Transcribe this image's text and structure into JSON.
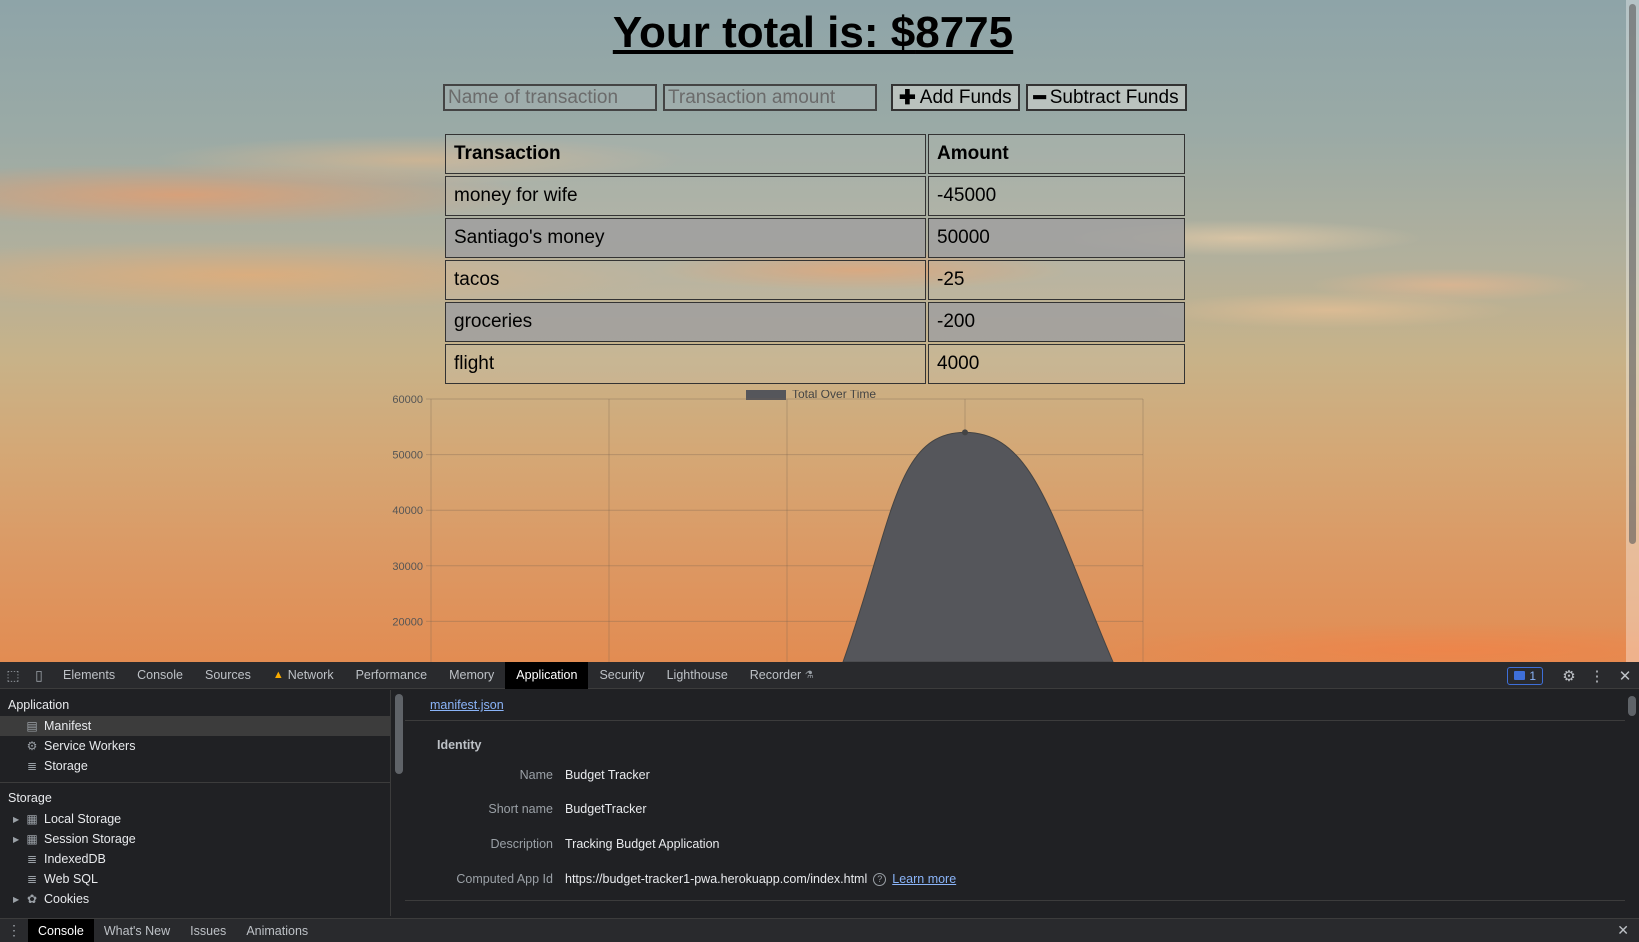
{
  "page": {
    "total_label": "Your total is: $",
    "total_value": "8775",
    "name_placeholder": "Name of transaction",
    "amount_placeholder": "Transaction amount",
    "add_label": "Add Funds",
    "subtract_label": "Subtract Funds",
    "add_icon": "plus-icon",
    "subtract_icon": "minus-icon"
  },
  "table": {
    "headers": [
      "Transaction",
      "Amount"
    ],
    "rows": [
      {
        "name": "money for wife",
        "amount": "-45000"
      },
      {
        "name": "Santiago's money",
        "amount": "50000"
      },
      {
        "name": "tacos",
        "amount": "-25"
      },
      {
        "name": "groceries",
        "amount": "-200"
      },
      {
        "name": "flight",
        "amount": "4000"
      }
    ]
  },
  "chart_data": {
    "type": "area",
    "title": "",
    "legend": [
      "Total Over Time"
    ],
    "legend_position": "top",
    "series": [
      {
        "name": "Total Over Time",
        "color": "#55565b",
        "points_visible": [
          {
            "x": 3,
            "y": 54000
          }
        ]
      }
    ],
    "y_ticks_visible": [
      60000,
      50000,
      40000,
      30000,
      20000
    ],
    "grid": true
  },
  "devtools": {
    "tabs": [
      "Elements",
      "Console",
      "Sources",
      "Network",
      "Performance",
      "Memory",
      "Application",
      "Security",
      "Lighthouse",
      "Recorder"
    ],
    "active_tab": "Application",
    "issues_count": "1",
    "sidebar": {
      "application_title": "Application",
      "application_items": [
        {
          "label": "Manifest",
          "icon": "file-icon"
        },
        {
          "label": "Service Workers",
          "icon": "gear-icon"
        },
        {
          "label": "Storage",
          "icon": "database-icon"
        }
      ],
      "storage_title": "Storage",
      "storage_items": [
        {
          "label": "Local Storage",
          "icon": "grid-icon",
          "expandable": true
        },
        {
          "label": "Session Storage",
          "icon": "grid-icon",
          "expandable": true
        },
        {
          "label": "IndexedDB",
          "icon": "database-icon",
          "expandable": false
        },
        {
          "label": "Web SQL",
          "icon": "database-icon",
          "expandable": false
        },
        {
          "label": "Cookies",
          "icon": "cookie-icon",
          "expandable": true
        }
      ]
    },
    "manifest": {
      "link": "manifest.json",
      "identity_title": "Identity",
      "fields": [
        {
          "label": "Name",
          "value": "Budget Tracker"
        },
        {
          "label": "Short name",
          "value": "BudgetTracker"
        },
        {
          "label": "Description",
          "value": "Tracking Budget Application"
        },
        {
          "label": "Computed App Id",
          "value": "https://budget-tracker1-pwa.herokuapp.com/index.html"
        }
      ],
      "learn_more": "Learn more"
    },
    "drawer_tabs": [
      "Console",
      "What's New",
      "Issues",
      "Animations"
    ],
    "drawer_active": "Console"
  }
}
